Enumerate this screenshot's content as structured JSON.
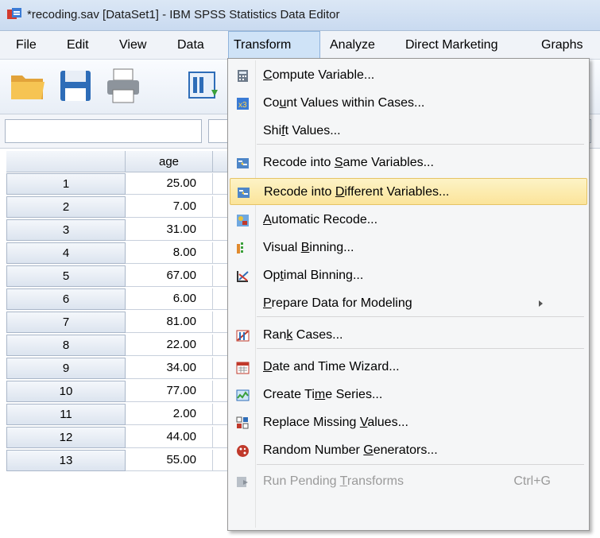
{
  "window": {
    "title": "*recoding.sav [DataSet1] - IBM SPSS Statistics Data Editor"
  },
  "menubar": [
    {
      "label": "File"
    },
    {
      "label": "Edit"
    },
    {
      "label": "View"
    },
    {
      "label": "Data"
    },
    {
      "label": "Transform"
    },
    {
      "label": "Analyze"
    },
    {
      "label": "Direct Marketing"
    },
    {
      "label": "Graphs"
    }
  ],
  "grid": {
    "columns": [
      "age"
    ],
    "rows": [
      {
        "n": "1",
        "age": "25.00"
      },
      {
        "n": "2",
        "age": "7.00"
      },
      {
        "n": "3",
        "age": "31.00"
      },
      {
        "n": "4",
        "age": "8.00"
      },
      {
        "n": "5",
        "age": "67.00"
      },
      {
        "n": "6",
        "age": "6.00"
      },
      {
        "n": "7",
        "age": "81.00"
      },
      {
        "n": "8",
        "age": "22.00"
      },
      {
        "n": "9",
        "age": "34.00"
      },
      {
        "n": "10",
        "age": "77.00"
      },
      {
        "n": "11",
        "age": "2.00"
      },
      {
        "n": "12",
        "age": "44.00"
      },
      {
        "n": "13",
        "age": "55.00"
      }
    ]
  },
  "transform_menu": {
    "items": [
      {
        "pre": "",
        "u": "C",
        "post": "ompute Variable...",
        "icon": "calculator-icon"
      },
      {
        "pre": "Co",
        "u": "u",
        "post": "nt Values within Cases...",
        "icon": "count-icon"
      },
      {
        "pre": "Shi",
        "u": "f",
        "post": "t Values...",
        "icon": ""
      },
      {
        "pre": "Recode into ",
        "u": "S",
        "post": "ame Variables...",
        "icon": "recode-icon"
      },
      {
        "pre": "Recode into ",
        "u": "D",
        "post": "ifferent Variables...",
        "icon": "recode-icon"
      },
      {
        "pre": "",
        "u": "A",
        "post": "utomatic Recode...",
        "icon": "automatic-recode-icon"
      },
      {
        "pre": "Visual ",
        "u": "B",
        "post": "inning...",
        "icon": "visual-binning-icon"
      },
      {
        "pre": "Op",
        "u": "t",
        "post": "imal Binning...",
        "icon": "optimal-binning-icon"
      },
      {
        "pre": "",
        "u": "P",
        "post": "repare Data for Modeling",
        "icon": ""
      },
      {
        "pre": "Ran",
        "u": "k",
        "post": " Cases...",
        "icon": "rank-icon"
      },
      {
        "pre": "",
        "u": "D",
        "post": "ate and Time Wizard...",
        "icon": "calendar-icon"
      },
      {
        "pre": "Create Ti",
        "u": "m",
        "post": "e Series...",
        "icon": "time-series-icon"
      },
      {
        "pre": "Replace Missing ",
        "u": "V",
        "post": "alues...",
        "icon": "replace-missing-icon"
      },
      {
        "pre": "Random Number ",
        "u": "G",
        "post": "enerators...",
        "icon": "dice-icon"
      },
      {
        "pre": "Run Pending ",
        "u": "T",
        "post": "ransforms",
        "icon": "run-pending-icon"
      }
    ],
    "highlighted": "Recode into Different Variables...",
    "shortcut_run_pending": "Ctrl+G"
  },
  "colors": {
    "highlight": "#fbe49a",
    "menu_bg": "#f5f6f7",
    "title_bg": "#c9daf0"
  }
}
